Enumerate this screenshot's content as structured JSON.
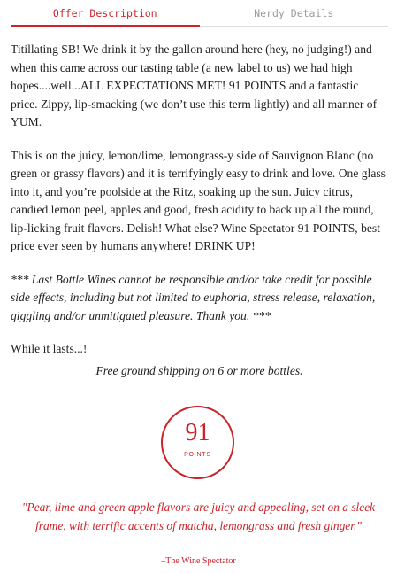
{
  "tabs": {
    "offer_description": "Offer Description",
    "nerdy_details": "Nerdy Details"
  },
  "description": {
    "paragraph_1": "Titillating SB! We drink it by the gallon around here (hey, no judging!) and when this came across our tasting table (a new label to us) we had high hopes....well...ALL EXPECTATIONS MET! 91 POINTS and a fantastic price. Zippy, lip-smacking (we don’t use this term lightly) and all manner of YUM.",
    "paragraph_2": "This is on the juicy, lemon/lime, lemongrass-y side of Sauvignon Blanc (no green or grassy flavors) and it is terrifyingly easy to drink and love. One glass into it, and you’re poolside at the Ritz, soaking up the sun. Juicy citrus, candied lemon peel, apples and good, fresh acidity to back up all the round, lip-licking fruit flavors. Delish! What else? Wine Spectator 91 POINTS, best price ever seen by humans anywhere! DRINK UP!",
    "disclaimer": "*** Last Bottle Wines cannot be responsible and/or take credit for possible side effects, including but not limited to euphoria, stress release, relaxation, giggling and/or unmitigated pleasure. Thank you. ***",
    "while_it_lasts": "While it lasts...!",
    "shipping": "Free ground shipping on 6 or more bottles."
  },
  "rating": {
    "score": "91",
    "label": "POINTS"
  },
  "review": {
    "quote": "\"Pear, lime and green apple flavors are juicy and appealing, set on a sleek frame, with terrific accents of matcha, lemongrass and fresh ginger.\"",
    "attribution": "–The Wine Spectator"
  },
  "colors": {
    "accent": "#cc2229",
    "text": "#222222",
    "inactive_tab": "#9a9a9a"
  }
}
